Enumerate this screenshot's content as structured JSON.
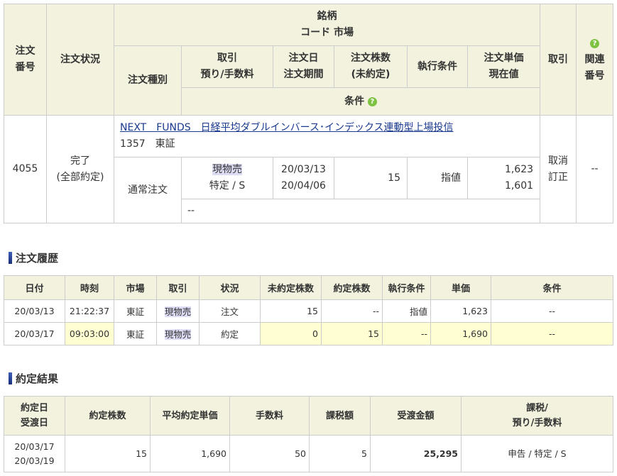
{
  "order": {
    "header": {
      "order_no": [
        "注文",
        "番号"
      ],
      "status": "注文状況",
      "issue": "銘柄",
      "code_market": "コード  市場",
      "order_type": "注文種別",
      "trade_deposit": [
        "取引",
        "預り/手数料"
      ],
      "order_date_period": [
        "注文日",
        "注文期間"
      ],
      "shares_unfilled": [
        "注文株数",
        "(未約定)"
      ],
      "exec_condition": "執行条件",
      "price_current": [
        "注文単価",
        "現在値"
      ],
      "trade": "取引",
      "related_no": [
        "関連",
        "番号"
      ],
      "condition": "条件",
      "help_glyph": "?"
    },
    "row": {
      "order_no": "4055",
      "status": [
        "完了",
        "(全部約定)"
      ],
      "issue_name": "NEXT　FUNDS　日経平均ダブルインバース･インデックス連動型上場投信",
      "code_market": "1357　東証",
      "order_type": "通常注文",
      "trade": "現物売",
      "deposit": "特定 / S",
      "order_date": "20/03/13",
      "period": "20/04/06",
      "shares": "15",
      "exec_condition": "指値",
      "price": "1,623",
      "current": "1,601",
      "actions": [
        "取消",
        "訂正"
      ],
      "related": "--",
      "condition": "--"
    }
  },
  "history": {
    "title": "注文履歴",
    "columns": [
      "日付",
      "時刻",
      "市場",
      "取引",
      "状況",
      "未約定株数",
      "約定株数",
      "執行条件",
      "単価",
      "条件"
    ],
    "rows": [
      [
        "20/03/13",
        "21:22:37",
        "東証",
        "現物売",
        "注文",
        "15",
        "--",
        "指値",
        "1,623",
        "--"
      ],
      [
        "20/03/17",
        "09:03:00",
        "東証",
        "現物売",
        "約定",
        "0",
        "15",
        "--",
        "1,690",
        "--"
      ]
    ]
  },
  "result": {
    "title": "約定結果",
    "columns": [
      [
        "約定日",
        "受渡日"
      ],
      [
        "約定株数"
      ],
      [
        "平均約定単価"
      ],
      [
        "手数料"
      ],
      [
        "課税額"
      ],
      [
        "受渡金額"
      ],
      [
        "課税/",
        "預り/手数料"
      ]
    ],
    "row": {
      "exec_date": "20/03/17",
      "settle_date": "20/03/19",
      "shares": "15",
      "avg_price": "1,690",
      "fee": "50",
      "tax": "5",
      "amount": "25,295",
      "tax_deposit": "申告 / 特定 / S"
    }
  }
}
